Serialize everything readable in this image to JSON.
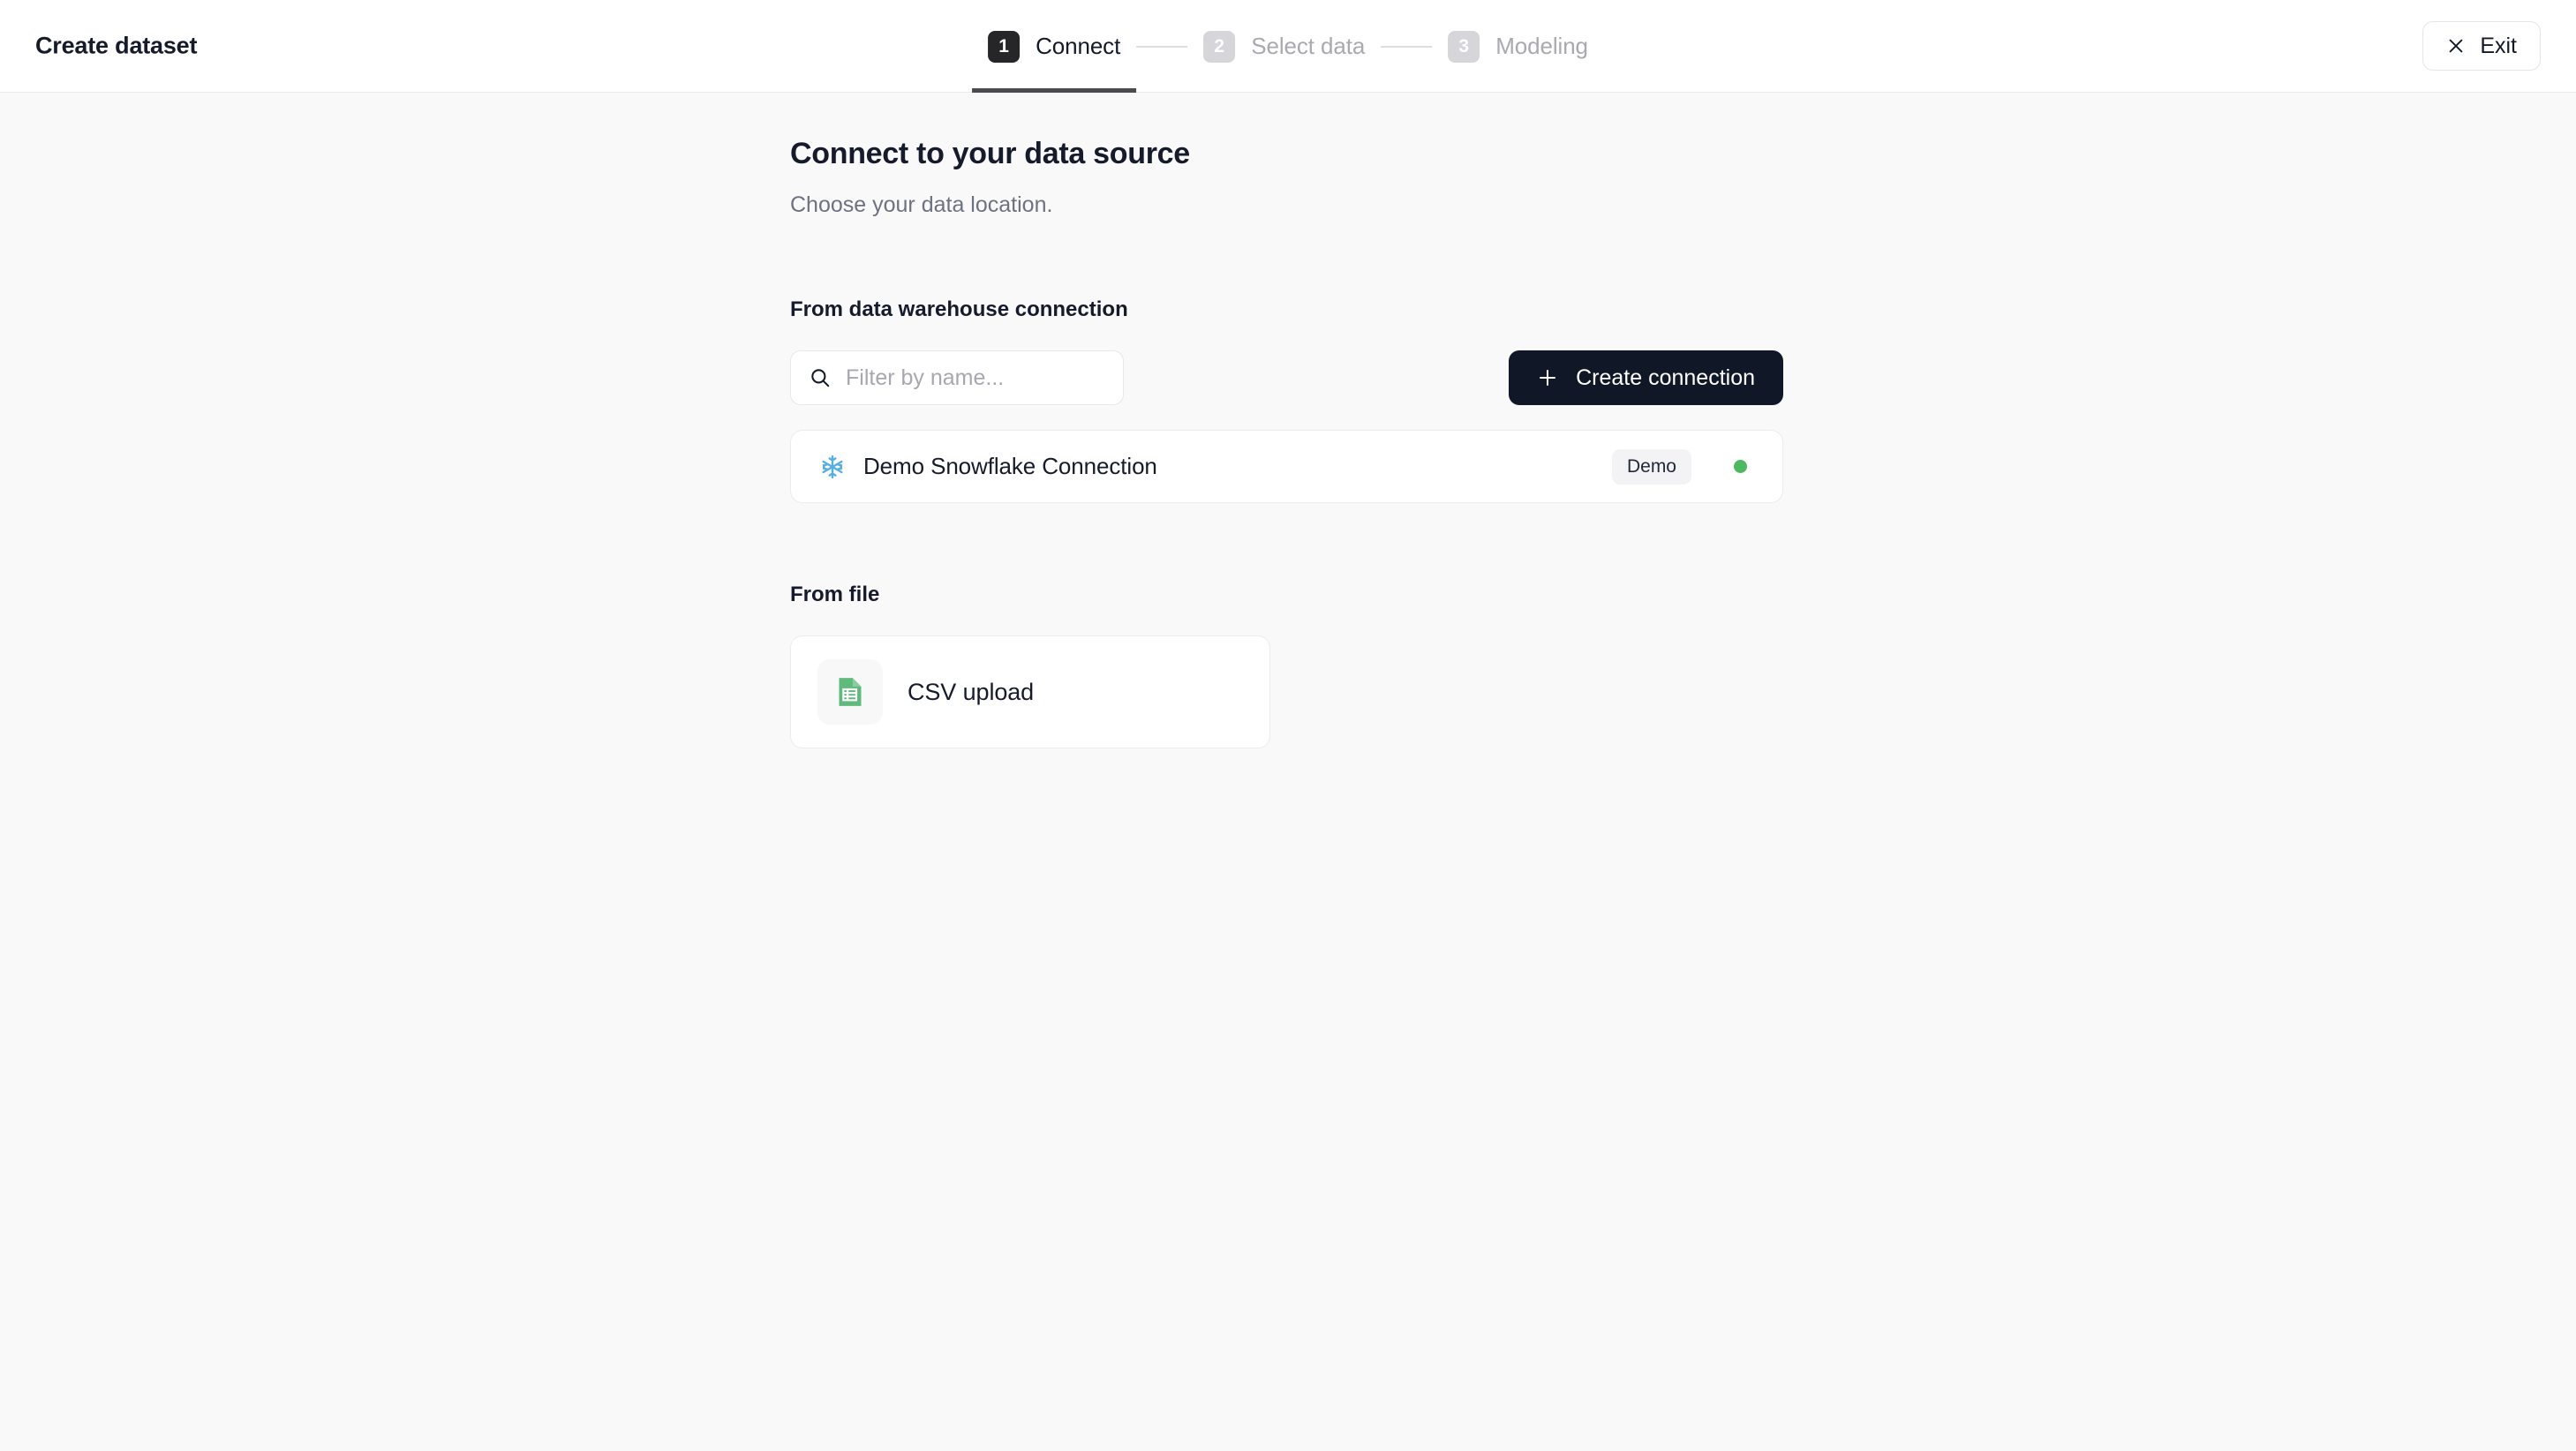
{
  "header": {
    "app_title": "Create dataset",
    "exit_label": "Exit",
    "exit_icon": "close-icon",
    "steps": [
      {
        "number": "1",
        "label": "Connect",
        "state": "active"
      },
      {
        "number": "2",
        "label": "Select data",
        "state": "inactive"
      },
      {
        "number": "3",
        "label": "Modeling",
        "state": "inactive"
      }
    ]
  },
  "main": {
    "heading": "Connect to your data source",
    "subheading": "Choose your data location.",
    "warehouse_section": {
      "title": "From data warehouse connection",
      "search": {
        "icon": "search-icon",
        "value": "",
        "placeholder": "Filter by name..."
      },
      "create_button": {
        "label": "Create connection",
        "icon": "plus-icon"
      },
      "connections": [
        {
          "icon": "snowflake-icon",
          "name": "Demo Snowflake Connection",
          "badge": "Demo",
          "status": "online"
        }
      ]
    },
    "file_section": {
      "title": "From file",
      "cards": [
        {
          "icon": "csv-file-icon",
          "label": "CSV upload"
        }
      ]
    }
  },
  "colors": {
    "page_background": "#f9f9fa",
    "surface": "#ffffff",
    "border": "#ececef",
    "text_primary": "#161b2b",
    "text_muted": "#6e7280",
    "accent_dark": "#101828",
    "step_active_badge": "#262629",
    "step_inactive_badge": "#d6d6da",
    "status_online": "#4cb860",
    "snowflake_blue": "#56aee4",
    "csv_green": "#61ba7d"
  }
}
